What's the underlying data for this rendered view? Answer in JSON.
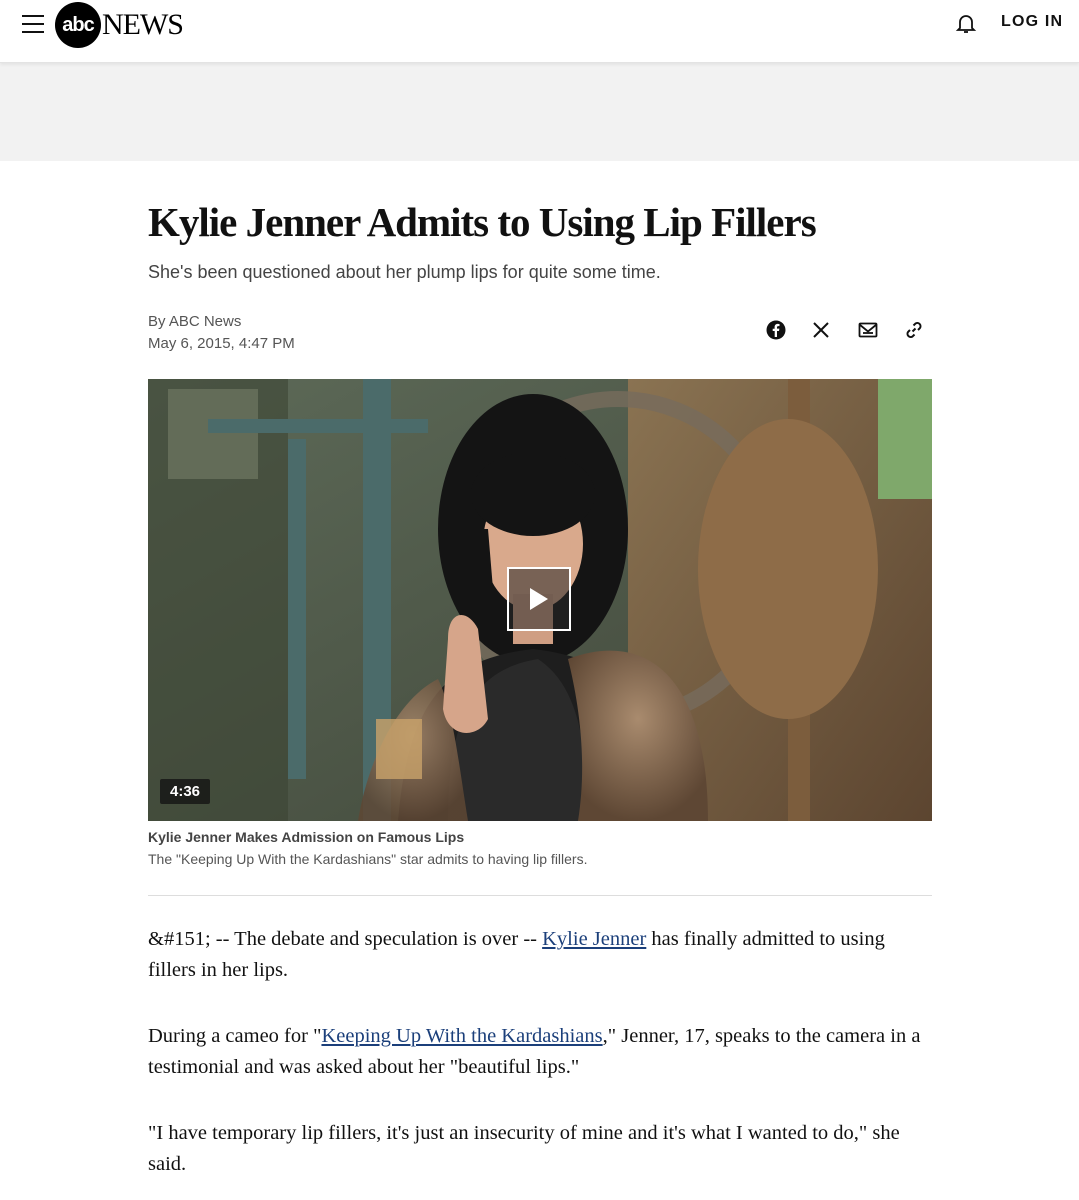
{
  "header": {
    "logo_abc": "abc",
    "logo_news": "NEWS",
    "login_label": "LOG IN"
  },
  "article": {
    "headline": "Kylie Jenner Admits to Using Lip Fillers",
    "subhead": "She's been questioned about her plump lips for quite some time.",
    "byline": "By ABC News",
    "date": "May 6, 2015, 4:47 PM"
  },
  "share": [
    "facebook-icon",
    "x-icon",
    "email-icon",
    "link-icon"
  ],
  "video": {
    "duration": "4:36",
    "caption_title": "Kylie Jenner Makes Admission on Famous Lips",
    "caption_desc": "The \"Keeping Up With the Kardashians\" star admits to having lip fillers."
  },
  "body": {
    "p1_pre": "&#151; -- The debate and speculation is over -- ",
    "p1_link": "Kylie Jenner",
    "p1_post": " has finally admitted to using fillers in her lips.",
    "p2_pre": "During a cameo for \"",
    "p2_link": "Keeping Up With the Kardashians",
    "p2_post": ",\" Jenner, 17, speaks to the camera in a testimonial and was asked about her \"beautiful lips.\"",
    "p3": "\"I have temporary lip fillers, it's just an insecurity of mine and it's what I wanted to do,\" she said."
  },
  "colors": {
    "link": "#1b3f7a",
    "ad_band": "#f2f2f2"
  }
}
